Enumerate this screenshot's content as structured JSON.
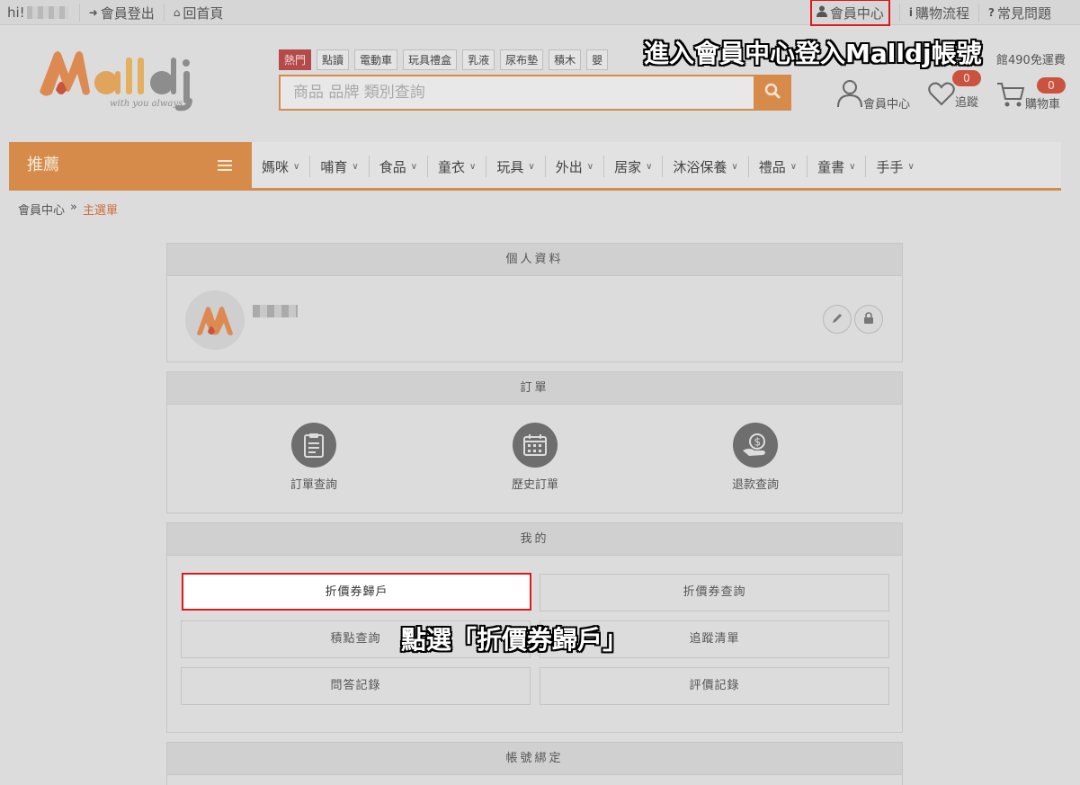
{
  "topbar": {
    "greeting": "hi!",
    "logout": "會員登出",
    "home": "回首頁",
    "member_center": "會員中心",
    "shopping_flow": "購物流程",
    "faq": "常見問題"
  },
  "header": {
    "logo_text": "Malldj",
    "logo_tagline": "with you always",
    "hot_tags": [
      "熱門",
      "點讀",
      "電動車",
      "玩具禮盒",
      "乳液",
      "尿布墊",
      "積木",
      "嬰"
    ],
    "free_shipping": "館490免運費",
    "search_placeholder": "商品 品牌 類別查詢",
    "member_label": "會員中心",
    "track_label": "追蹤",
    "track_count": "0",
    "cart_label": "購物車",
    "cart_count": "0"
  },
  "nav": {
    "recommend": "推薦",
    "items": [
      "媽咪",
      "哺育",
      "食品",
      "童衣",
      "玩具",
      "外出",
      "居家",
      "沐浴保養",
      "禮品",
      "童書",
      "手手"
    ]
  },
  "breadcrumb": {
    "root": "會員中心",
    "sep": "»",
    "current": "主選單"
  },
  "profile": {
    "title": "個人資料"
  },
  "orders": {
    "title": "訂單",
    "items": [
      "訂單查詢",
      "歷史訂單",
      "退款查詢"
    ]
  },
  "mine": {
    "title": "我的",
    "buttons": [
      "折價券歸戶",
      "折價券查詢",
      "積點查詢",
      "追蹤清單",
      "問答記錄",
      "評價記錄"
    ]
  },
  "account_binding": {
    "title": "帳號綁定"
  },
  "annotations": {
    "top": "進入會員中心登入Malldj帳號",
    "middle": "點選「折價券歸戶」"
  },
  "colors": {
    "brand_orange": "#d68b4a",
    "highlight_red": "#e0181b",
    "badge_red": "#c9533e"
  }
}
